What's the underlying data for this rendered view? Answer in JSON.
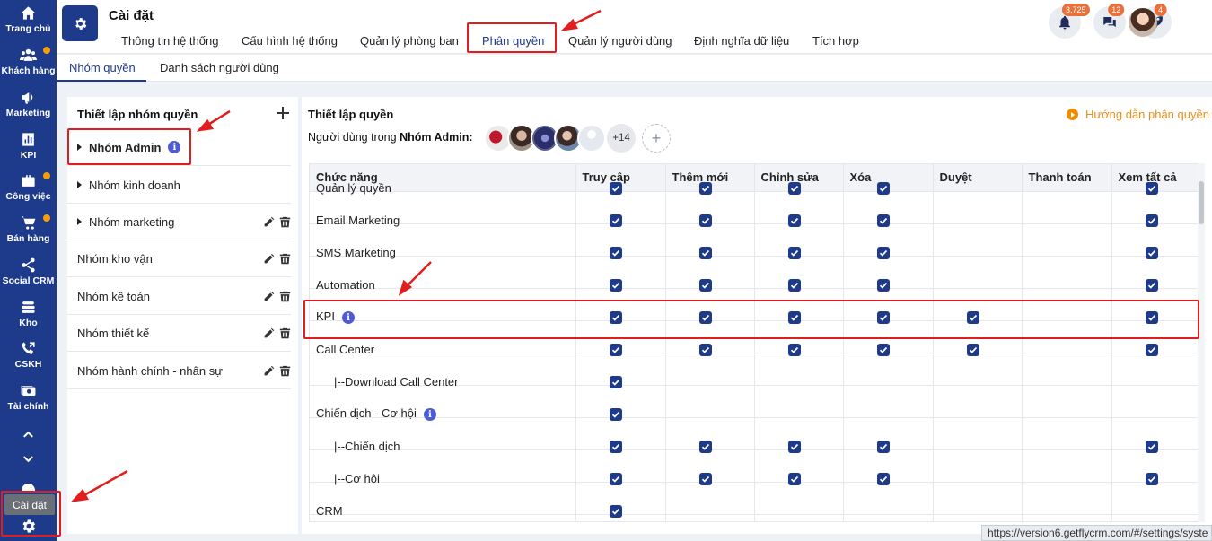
{
  "sidebar": {
    "items": [
      {
        "label": "Trang chủ",
        "icon": "home-icon"
      },
      {
        "label": "Khách hàng",
        "icon": "users-icon"
      },
      {
        "label": "Marketing",
        "icon": "megaphone-icon"
      },
      {
        "label": "KPI",
        "icon": "chart-icon"
      },
      {
        "label": "Công việc",
        "icon": "briefcase-icon"
      },
      {
        "label": "Bán hàng",
        "icon": "cart-icon"
      },
      {
        "label": "Social CRM",
        "icon": "share-icon"
      },
      {
        "label": "Kho",
        "icon": "stack-icon"
      },
      {
        "label": "CSKH",
        "icon": "phone-icon"
      },
      {
        "label": "Tài chính",
        "icon": "money-icon"
      }
    ],
    "settings_tooltip": "Cài đặt"
  },
  "header": {
    "title": "Cài đặt",
    "tabs": [
      {
        "label": "Thông tin hệ thống"
      },
      {
        "label": "Cấu hình hệ thống"
      },
      {
        "label": "Quản lý phòng ban"
      },
      {
        "label": "Phân quyền"
      },
      {
        "label": "Quản lý người dùng"
      },
      {
        "label": "Định nghĩa dữ liệu"
      },
      {
        "label": "Tích hợp"
      }
    ],
    "notifications_count": "3,725",
    "messages_count": "12",
    "updates_count": "4"
  },
  "subtabs": [
    {
      "label": "Nhóm quyền"
    },
    {
      "label": "Danh sách người dùng"
    }
  ],
  "groups_panel": {
    "title": "Thiết lập nhóm quyền",
    "groups": [
      {
        "label": "Nhóm Admin"
      },
      {
        "label": "Nhóm kinh doanh"
      },
      {
        "label": "Nhóm marketing"
      },
      {
        "label": "Nhóm kho vận"
      },
      {
        "label": "Nhóm kế toán"
      },
      {
        "label": "Nhóm thiết kế"
      },
      {
        "label": "Nhóm hành chính - nhân sự"
      }
    ]
  },
  "permissions_panel": {
    "title": "Thiết lập quyền",
    "guide_link": "Hướng dẫn phân quyền",
    "users_label": "Người dùng trong",
    "group_name": "Nhóm Admin:",
    "more_users": "+14",
    "add_user": "+",
    "columns": [
      "Chức năng",
      "Truy cập",
      "Thêm mới",
      "Chỉnh sửa",
      "Xóa",
      "Duyệt",
      "Thanh toán",
      "Xem tất cả"
    ],
    "rows": [
      {
        "name": "Quản lý quyền",
        "info": false,
        "perms": [
          true,
          true,
          true,
          true,
          false,
          false,
          true
        ]
      },
      {
        "name": "Email Marketing",
        "info": false,
        "perms": [
          true,
          true,
          true,
          true,
          false,
          false,
          true
        ]
      },
      {
        "name": "SMS Marketing",
        "info": false,
        "perms": [
          true,
          true,
          true,
          true,
          false,
          false,
          true
        ]
      },
      {
        "name": "Automation",
        "info": false,
        "perms": [
          true,
          true,
          true,
          true,
          false,
          false,
          true
        ]
      },
      {
        "name": "KPI",
        "info": true,
        "perms": [
          true,
          true,
          true,
          true,
          true,
          false,
          true
        ]
      },
      {
        "name": "Call Center",
        "info": false,
        "perms": [
          true,
          true,
          true,
          true,
          true,
          false,
          true
        ]
      },
      {
        "name": "|--Download Call Center",
        "info": false,
        "indent": true,
        "perms": [
          true,
          false,
          false,
          false,
          false,
          false,
          false
        ]
      },
      {
        "name": "Chiến dịch - Cơ hội",
        "info": true,
        "perms": [
          true,
          false,
          false,
          false,
          false,
          false,
          false
        ]
      },
      {
        "name": "|--Chiến dịch",
        "info": false,
        "indent": true,
        "perms": [
          true,
          true,
          true,
          true,
          false,
          false,
          true
        ]
      },
      {
        "name": "|--Cơ hội",
        "info": false,
        "indent": true,
        "perms": [
          true,
          true,
          true,
          true,
          false,
          false,
          true
        ]
      },
      {
        "name": "CRM",
        "info": false,
        "perms": [
          true,
          false,
          false,
          false,
          false,
          false,
          false
        ]
      }
    ]
  },
  "status_url": "https://version6.getflycrm.com/#/settings/syste",
  "colors": {
    "sidebar": "#1e3a8a",
    "accent": "#1e3a8a",
    "badge": "#e8703a",
    "highlight": "#e11d1d",
    "guide": "#e8901a"
  }
}
